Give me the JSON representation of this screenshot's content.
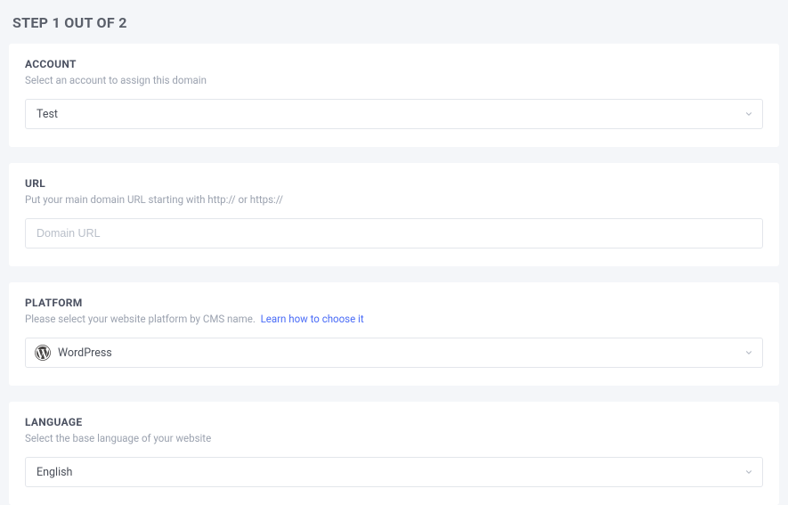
{
  "step": {
    "title": "STEP 1 OUT OF 2"
  },
  "account": {
    "label": "ACCOUNT",
    "help": "Select an account to assign this domain",
    "selected": "Test"
  },
  "url": {
    "label": "URL",
    "help": "Put your main domain URL starting with http:// or https://",
    "placeholder": "Domain URL",
    "value": ""
  },
  "platform": {
    "label": "PLATFORM",
    "help_prefix": "Please select your website platform by CMS name.",
    "help_link": "Learn how to choose it",
    "selected": "WordPress"
  },
  "language": {
    "label": "LANGUAGE",
    "help": "Select the base language of your website",
    "selected": "English"
  }
}
